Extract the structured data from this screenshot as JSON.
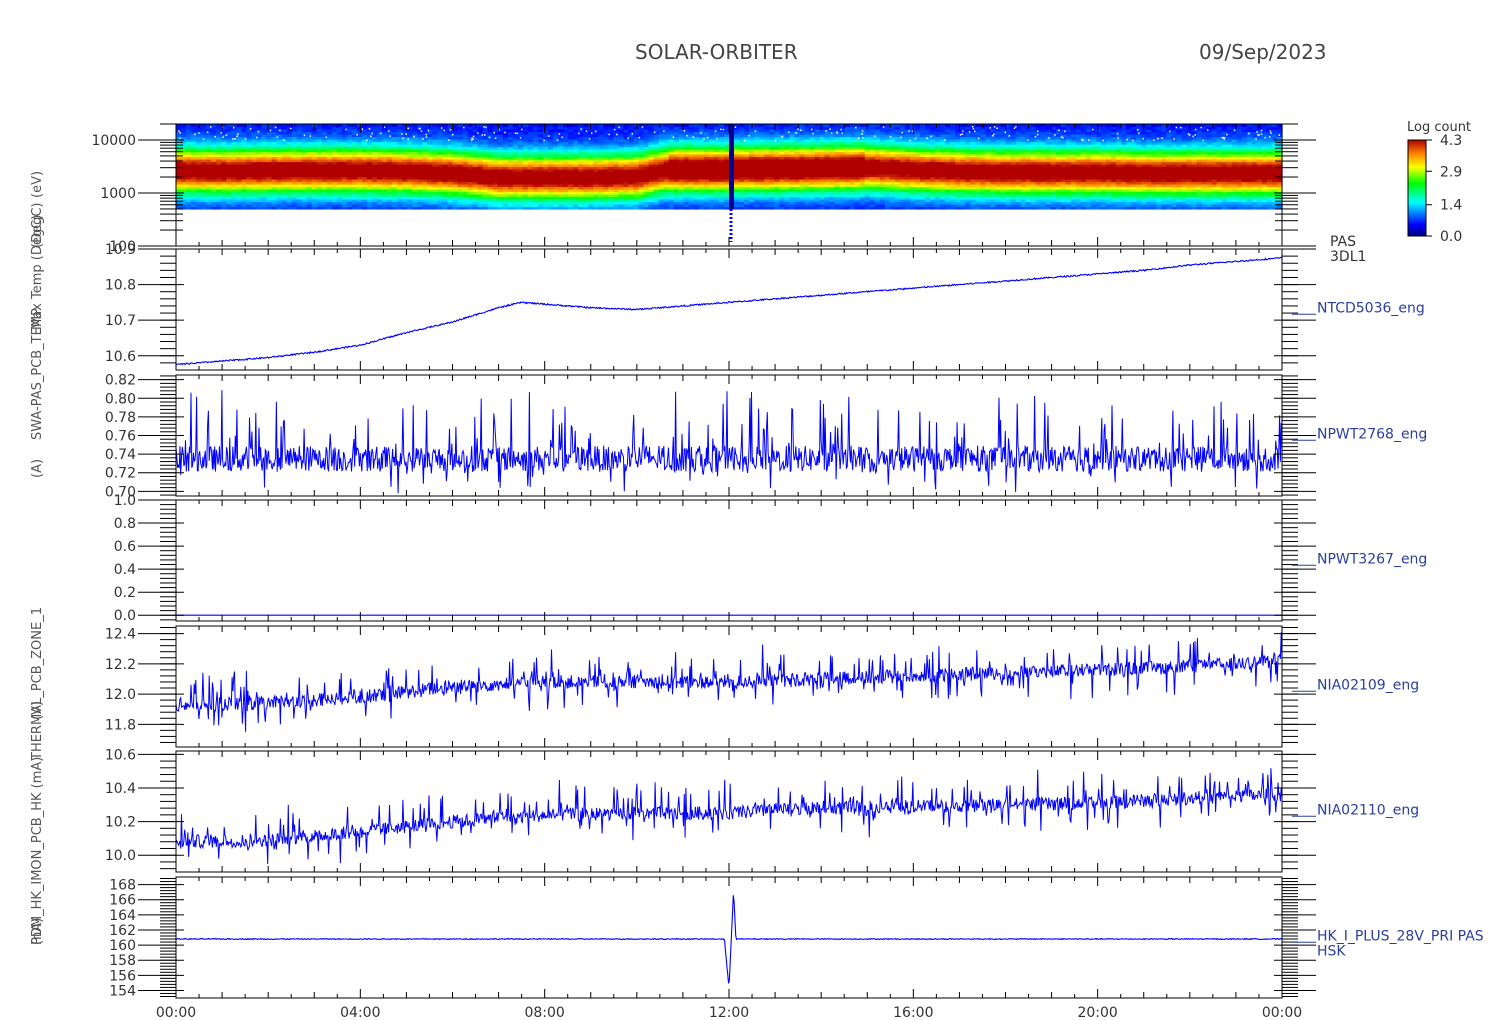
{
  "header": {
    "spacecraft": "SOLAR-ORBITER",
    "date": "09/Sep/2023"
  },
  "colors": {
    "trace": "#0000ff",
    "axis": "#000000",
    "label": "#2a3f9e",
    "tick_text": "#333333"
  },
  "colorbar": {
    "title": "Log count",
    "ticks": [
      "4.3",
      "2.9",
      "1.4",
      "0.0"
    ],
    "range": [
      0.0,
      4.3
    ]
  },
  "y_axis_labels_overlap": [
    "(eV)",
    "(DegC)",
    "Max Temp (DegC)",
    "(A)",
    "SWA-PAS_PCB_TEMP",
    "(V)",
    "(nA)",
    "PDM_HK_IMON_PCB_HK (mA)",
    "THERMAL_PCB_ZONE_1"
  ],
  "chart_data": [
    {
      "type": "heatmap",
      "label": "PAS\n3DL1",
      "label_lines": [
        "PAS",
        "3DL1"
      ],
      "ylabel": "(eV)",
      "yscale": "log",
      "ylim": [
        100,
        20000
      ],
      "yticks": [
        "10000",
        "1000",
        "100"
      ],
      "ytick_values": [
        10000,
        1000,
        100
      ],
      "x_hours": [
        0,
        1,
        2,
        3,
        4,
        5,
        6,
        7,
        8,
        9,
        10,
        10.7,
        11,
        12,
        12.1,
        13,
        14,
        15,
        16,
        17,
        18,
        19,
        20,
        21,
        22,
        23,
        24
      ],
      "peak_energy_eV": [
        2700,
        2600,
        2700,
        2700,
        2700,
        2600,
        2400,
        2000,
        2000,
        2000,
        2100,
        2800,
        2800,
        2800,
        2900,
        2900,
        3000,
        3100,
        2800,
        2600,
        2500,
        2500,
        2500,
        2400,
        2400,
        2400,
        2400
      ],
      "peak_log_count": 4.3,
      "gaps": [
        {
          "start_hour": 12.0,
          "end_hour": 12.1
        }
      ]
    },
    {
      "type": "line",
      "label": "NTCD5036_eng",
      "ylim": [
        10.56,
        10.9
      ],
      "yticks": [
        "10.9",
        "10.8",
        "10.7",
        "10.6"
      ],
      "ytick_values": [
        10.9,
        10.8,
        10.7,
        10.6
      ],
      "x_hours": [
        0,
        1,
        2,
        3,
        4,
        5,
        6,
        7,
        7.5,
        8,
        9,
        10,
        11,
        12,
        13,
        14,
        15,
        16,
        17,
        18,
        19,
        20,
        21,
        22,
        23,
        24
      ],
      "values": [
        10.575,
        10.585,
        10.595,
        10.61,
        10.63,
        10.665,
        10.695,
        10.735,
        10.75,
        10.745,
        10.735,
        10.73,
        10.74,
        10.75,
        10.76,
        10.77,
        10.78,
        10.79,
        10.8,
        10.81,
        10.82,
        10.83,
        10.84,
        10.855,
        10.865,
        10.875
      ],
      "noise": 0.004
    },
    {
      "type": "line",
      "label": "NPWT2768_eng",
      "ylim": [
        0.695,
        0.825
      ],
      "yticks": [
        "0.82",
        "0.80",
        "0.78",
        "0.76",
        "0.74",
        "0.72",
        "0.70"
      ],
      "ytick_values": [
        0.82,
        0.8,
        0.78,
        0.76,
        0.74,
        0.72,
        0.7
      ],
      "x_hours": [
        0,
        24
      ],
      "values": [
        0.735,
        0.735
      ],
      "spread": [
        0.71,
        0.81
      ],
      "noise": 0.02
    },
    {
      "type": "line",
      "label": "NPWT3267_eng",
      "ylim": [
        -0.05,
        1.0
      ],
      "yticks": [
        "1.0",
        "0.8",
        "0.6",
        "0.4",
        "0.2",
        "0.0"
      ],
      "ytick_values": [
        1.0,
        0.8,
        0.6,
        0.4,
        0.2,
        0.0
      ],
      "x_hours": [
        0,
        24
      ],
      "values": [
        0.0,
        0.0
      ],
      "noise": 0.0
    },
    {
      "type": "line",
      "label": "NIA02109_eng",
      "ylim": [
        11.65,
        12.45
      ],
      "yticks": [
        "12.4",
        "12.2",
        "12.0",
        "11.8"
      ],
      "ytick_values": [
        12.4,
        12.2,
        12.0,
        11.8
      ],
      "x_hours": [
        0,
        2,
        4,
        6,
        8,
        10,
        12,
        14,
        16,
        18,
        20,
        22,
        23,
        24
      ],
      "values": [
        11.93,
        11.94,
        11.98,
        12.05,
        12.08,
        12.08,
        12.08,
        12.1,
        12.12,
        12.14,
        12.16,
        12.18,
        12.2,
        12.22
      ],
      "noise": 0.09
    },
    {
      "type": "line",
      "label": "NIA02110_eng",
      "ylim": [
        9.9,
        10.62
      ],
      "yticks": [
        "10.6",
        "10.4",
        "10.2",
        "10.0"
      ],
      "ytick_values": [
        10.6,
        10.4,
        10.2,
        10.0
      ],
      "x_hours": [
        0,
        2,
        4,
        6,
        8,
        10,
        12,
        14,
        16,
        18,
        20,
        22,
        23,
        24
      ],
      "values": [
        10.08,
        10.09,
        10.14,
        10.2,
        10.24,
        10.25,
        10.25,
        10.28,
        10.29,
        10.3,
        10.31,
        10.34,
        10.35,
        10.36
      ],
      "noise": 0.08
    },
    {
      "type": "line",
      "label": "HK_I_PLUS_28V_PRI PAS\nHSK",
      "label_lines": [
        "HK_I_PLUS_28V_PRI PAS",
        "HSK"
      ],
      "ylim": [
        153,
        169
      ],
      "yticks": [
        "168",
        "166",
        "164",
        "162",
        "160",
        "158",
        "156",
        "154"
      ],
      "ytick_values": [
        168,
        166,
        164,
        162,
        160,
        158,
        156,
        154
      ],
      "x_hours": [
        0,
        11.9,
        12.0,
        12.05,
        12.1,
        12.15,
        24
      ],
      "values": [
        160.8,
        160.8,
        154.3,
        161.0,
        167.3,
        160.8,
        160.8
      ],
      "noise": 0.12
    }
  ],
  "x_axis": {
    "ticks": [
      "00:00",
      "04:00",
      "08:00",
      "12:00",
      "16:00",
      "20:00",
      "00:00"
    ],
    "tick_hours": [
      0,
      4,
      8,
      12,
      16,
      20,
      24
    ],
    "range_hours": [
      0,
      24
    ]
  }
}
